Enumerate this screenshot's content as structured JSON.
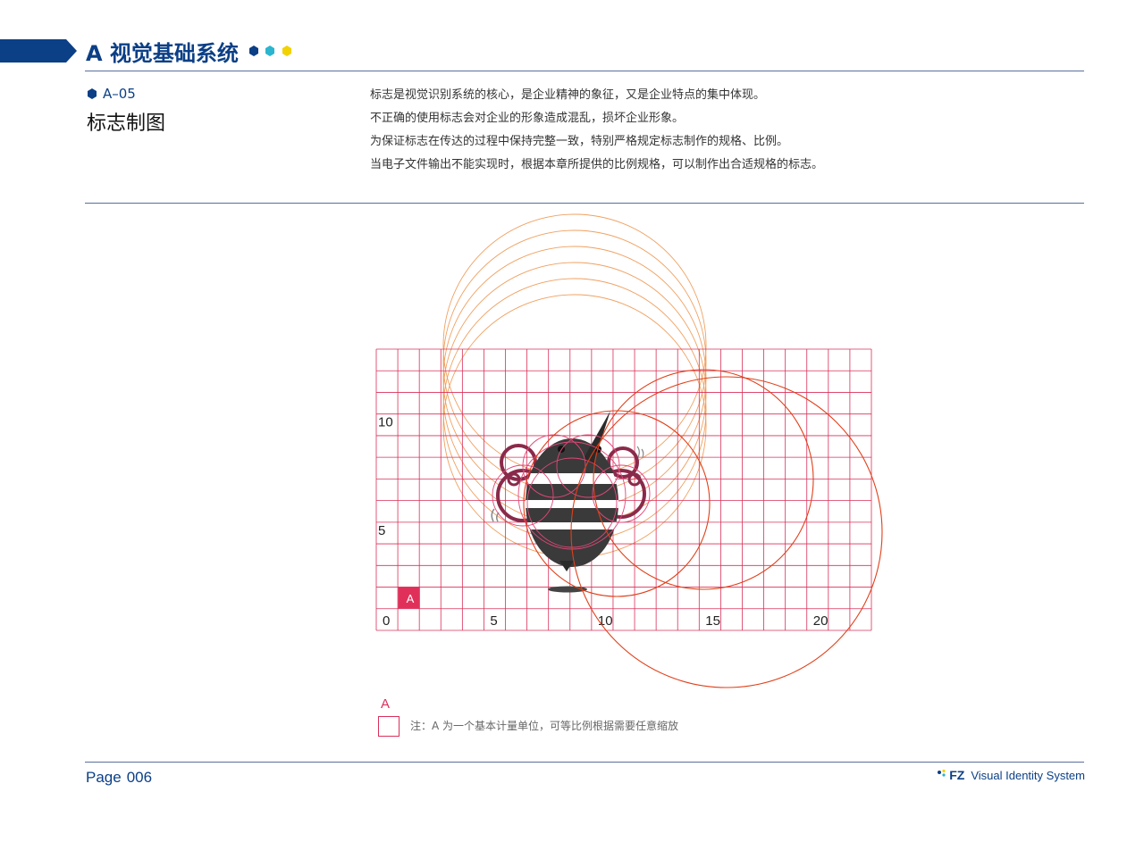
{
  "header": {
    "section_title": "A 视觉基础系统",
    "accent_colors": [
      "#0b3f86",
      "#2bb5cf",
      "#f2d200"
    ]
  },
  "page": {
    "code": "A–05",
    "heading": "标志制图",
    "description": [
      "标志是视觉识别系统的核心，是企业精神的象征，又是企业特点的集中体现。",
      "不正确的使用标志会对企业的形象造成混乱，损坏企业形象。",
      "为保证标志在传达的过程中保持完整一致，特别严格规定标志制作的规格、比例。",
      "当电子文件输出不能实现时，根据本章所提供的比例规格，可以制作出合适规格的标志。"
    ]
  },
  "diagram": {
    "grid_columns": 23,
    "grid_rows": 13,
    "unit_label": "A",
    "x_axis_labels": [
      {
        "text": "0",
        "value": 0
      },
      {
        "text": "5",
        "value": 5
      },
      {
        "text": "10",
        "value": 10
      },
      {
        "text": "15",
        "value": 15
      },
      {
        "text": "20",
        "value": 20
      }
    ],
    "y_axis_labels": [
      {
        "text": "5",
        "value": 5
      },
      {
        "text": "10",
        "value": 10
      }
    ],
    "grid_color": "#d9305a",
    "guide_color_light": "#f0a060",
    "guide_color_dark": "#e0401a",
    "logo_colors": {
      "body": "#3a3a3a",
      "stripe": "#ffffff",
      "wing": "#8a2a4a"
    }
  },
  "note": {
    "label": "A",
    "text": "注：A 为一个基本计量单位，可等比例根据需要任意缩放"
  },
  "footer": {
    "page_word": "Page",
    "page_number": "006",
    "brand_mark": "FZ",
    "brand_text": "Visual Identity System"
  }
}
